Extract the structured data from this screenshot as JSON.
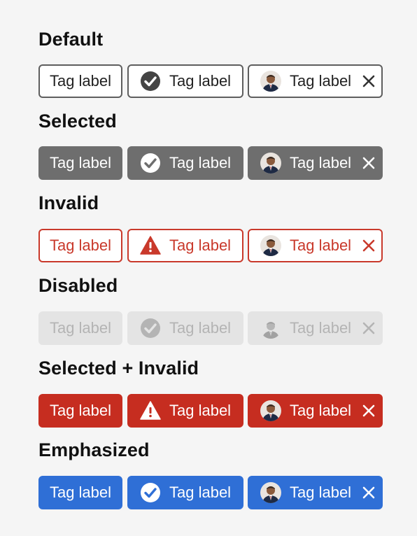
{
  "sections": [
    {
      "heading": "Default",
      "tags": [
        "Tag label",
        "Tag label",
        "Tag label"
      ]
    },
    {
      "heading": "Selected",
      "tags": [
        "Tag label",
        "Tag label",
        "Tag label"
      ]
    },
    {
      "heading": "Invalid",
      "tags": [
        "Tag label",
        "Tag label",
        "Tag label"
      ]
    },
    {
      "heading": "Disabled",
      "tags": [
        "Tag label",
        "Tag label",
        "Tag label"
      ]
    },
    {
      "heading": "Selected + Invalid",
      "tags": [
        "Tag label",
        "Tag label",
        "Tag label"
      ]
    },
    {
      "heading": "Emphasized",
      "tags": [
        "Tag label",
        "Tag label",
        "Tag label"
      ]
    }
  ],
  "icons": {
    "checkmark": "checkmark-circle-icon",
    "alert": "alert-triangle-icon",
    "avatar": "avatar",
    "remove": "close-icon"
  },
  "colors": {
    "background": "#f5f5f5",
    "default_border": "#5e5e5e",
    "selected_fill": "#6e6e6e",
    "invalid_red": "#c9392b",
    "disabled_fill": "#e4e4e4",
    "disabled_text": "#b4b4b4",
    "selected_invalid_fill": "#c62d20",
    "emphasized_fill": "#2f6fd6"
  }
}
